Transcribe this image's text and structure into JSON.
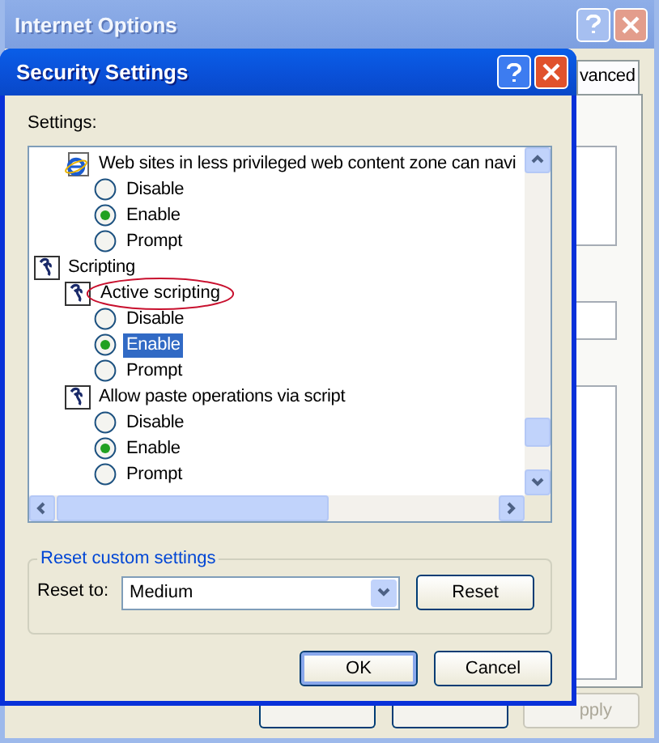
{
  "background_window": {
    "title": "Internet Options",
    "tab": "vanced",
    "apply_button": "pply"
  },
  "dialog": {
    "title": "Security Settings",
    "settings_label": "Settings:",
    "tree": [
      {
        "kind": "setting",
        "label": "Web sites in less privileged web content zone can navi",
        "circled": false,
        "children": [
          {
            "kind": "option",
            "label": "Disable",
            "checked": false,
            "selected": false
          },
          {
            "kind": "option",
            "label": "Enable",
            "checked": true,
            "selected": false
          },
          {
            "kind": "option",
            "label": "Prompt",
            "checked": false,
            "selected": false
          }
        ]
      },
      {
        "kind": "category",
        "label": "Scripting",
        "children": [
          {
            "kind": "setting",
            "label": "Active scripting",
            "circled": true,
            "children": [
              {
                "kind": "option",
                "label": "Disable",
                "checked": false,
                "selected": false
              },
              {
                "kind": "option",
                "label": "Enable",
                "checked": true,
                "selected": true
              },
              {
                "kind": "option",
                "label": "Prompt",
                "checked": false,
                "selected": false
              }
            ]
          },
          {
            "kind": "setting",
            "label": "Allow paste operations via script",
            "circled": false,
            "children": [
              {
                "kind": "option",
                "label": "Disable",
                "checked": false,
                "selected": false
              },
              {
                "kind": "option",
                "label": "Enable",
                "checked": true,
                "selected": false
              },
              {
                "kind": "option",
                "label": "Prompt",
                "checked": false,
                "selected": false
              }
            ]
          }
        ]
      }
    ],
    "reset": {
      "legend": "Reset custom settings",
      "label": "Reset to:",
      "value": "Medium",
      "button": "Reset"
    },
    "buttons": [
      {
        "label": "OK",
        "default": true
      },
      {
        "label": "Cancel",
        "default": false
      }
    ]
  }
}
